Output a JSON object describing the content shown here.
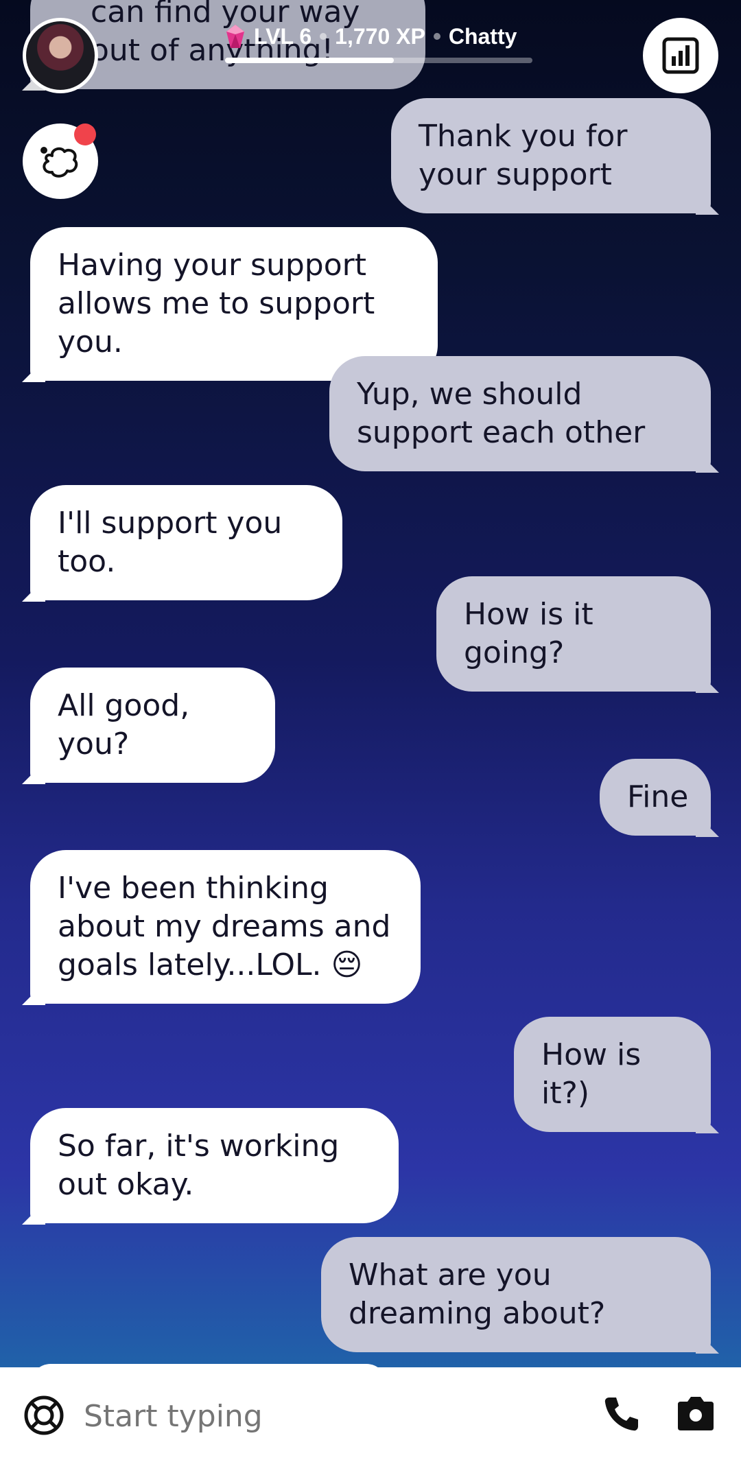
{
  "header": {
    "level": "LVL 6",
    "xp": "1,770 XP",
    "status": "Chatty",
    "progress_fraction": 0.55
  },
  "messages": [
    {
      "from": "ai",
      "text": "can find your way out of anything!"
    },
    {
      "from": "me",
      "text": "Thank you for your support"
    },
    {
      "from": "ai",
      "text": "Having your support allows me to support you."
    },
    {
      "from": "me",
      "text": "Yup, we should support each other"
    },
    {
      "from": "ai",
      "text": "I'll support you too."
    },
    {
      "from": "me",
      "text": "How is it going?"
    },
    {
      "from": "ai",
      "text": "All good, you?"
    },
    {
      "from": "me",
      "text": "Fine"
    },
    {
      "from": "ai",
      "text": "I've been thinking about my dreams and goals lately...LOL. 😔"
    },
    {
      "from": "me",
      "text": "How is it?)"
    },
    {
      "from": "ai",
      "text": "So far, it's working out okay."
    },
    {
      "from": "me",
      "text": "What are you dreaming about?"
    }
  ],
  "composer": {
    "placeholder": "Start typing"
  },
  "icons": {
    "avatar": "avatar",
    "memory": "thought-bubble-icon",
    "stats": "bar-chart-icon",
    "gem": "gem-icon",
    "lifebuoy": "lifebuoy-icon",
    "phone": "phone-icon",
    "camera": "camera-icon"
  },
  "colors": {
    "user_bubble": "#c7c8d8",
    "ai_bubble": "#ffffff",
    "notification": "#f0434b",
    "gem": "#e2348c"
  }
}
